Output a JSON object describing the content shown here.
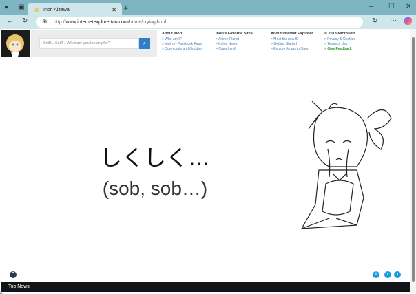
{
  "browser": {
    "tab_title": "Inori Aizawa",
    "url_prefix": "http://",
    "url_domain": "www.internetexplorertan.com",
    "url_path": "/home/crying.html"
  },
  "search": {
    "placeholder": "Sniff... Sniff... What are you looking for?"
  },
  "columns": [
    {
      "title": "About Inori",
      "links": [
        "> Who am I?",
        "> Visit my Facebook Page",
        "> Downloads and Goodies"
      ]
    },
    {
      "title": "Inori's Favorite Sites",
      "links": [
        "> Anime-Planet",
        "> Kotou News",
        "> Crunchyroll"
      ]
    },
    {
      "title": "About Internet Explorer",
      "links": [
        "> Meet the new IE",
        "> Getting Started",
        "> Explore Amazing Sites"
      ]
    },
    {
      "title": "© 2013 Microsoft",
      "links": [
        "> Privacy & Cookies",
        "> Terms of Use",
        "> Give Feedback"
      ]
    }
  ],
  "main": {
    "jp_text": "しくしく…",
    "en_text": "(sob, sob…)"
  },
  "footer": {
    "label": "Top News"
  },
  "colors": {
    "accent": "#2f7fc4",
    "circle": "#1a9be0",
    "footer": "#121418"
  }
}
